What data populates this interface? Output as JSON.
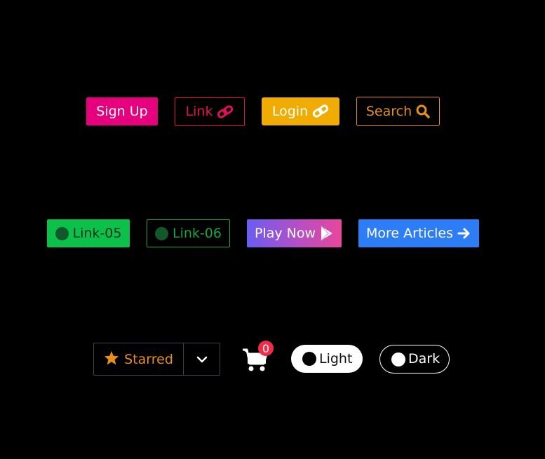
{
  "colors": {
    "pink": "#e6007e",
    "crimson": "#e2105c",
    "amber": "#f0ac00",
    "orange": "#e6901a",
    "green": "#0bc14a",
    "dark_green": "#12331d",
    "green_outline": "#17a63f",
    "blue": "#2d7df6",
    "badge_red": "#f02c49",
    "gradient_start": "#6a5df2",
    "gradient_end": "#e8479c"
  },
  "row1": {
    "signup_label": "Sign Up",
    "link_label": "Link",
    "link_icon": "link-icon",
    "login_label": "Login",
    "login_icon": "link-icon",
    "search_label": "Search",
    "search_icon": "search-icon"
  },
  "row2": {
    "link05_label": "Link-05",
    "link05_icon": "dot-icon",
    "link06_label": "Link-06",
    "link06_icon": "dot-icon",
    "playnow_label": "Play Now",
    "playnow_icon": "play-store-icon",
    "more_label": "More Articles",
    "more_icon": "arrow-right-icon"
  },
  "row3": {
    "starred_label": "Starred",
    "starred_icon": "star-icon",
    "dropdown_icon": "chevron-down-icon",
    "cart_icon": "cart-icon",
    "cart_count": "0",
    "light_label": "Light",
    "dark_label": "Dark"
  }
}
